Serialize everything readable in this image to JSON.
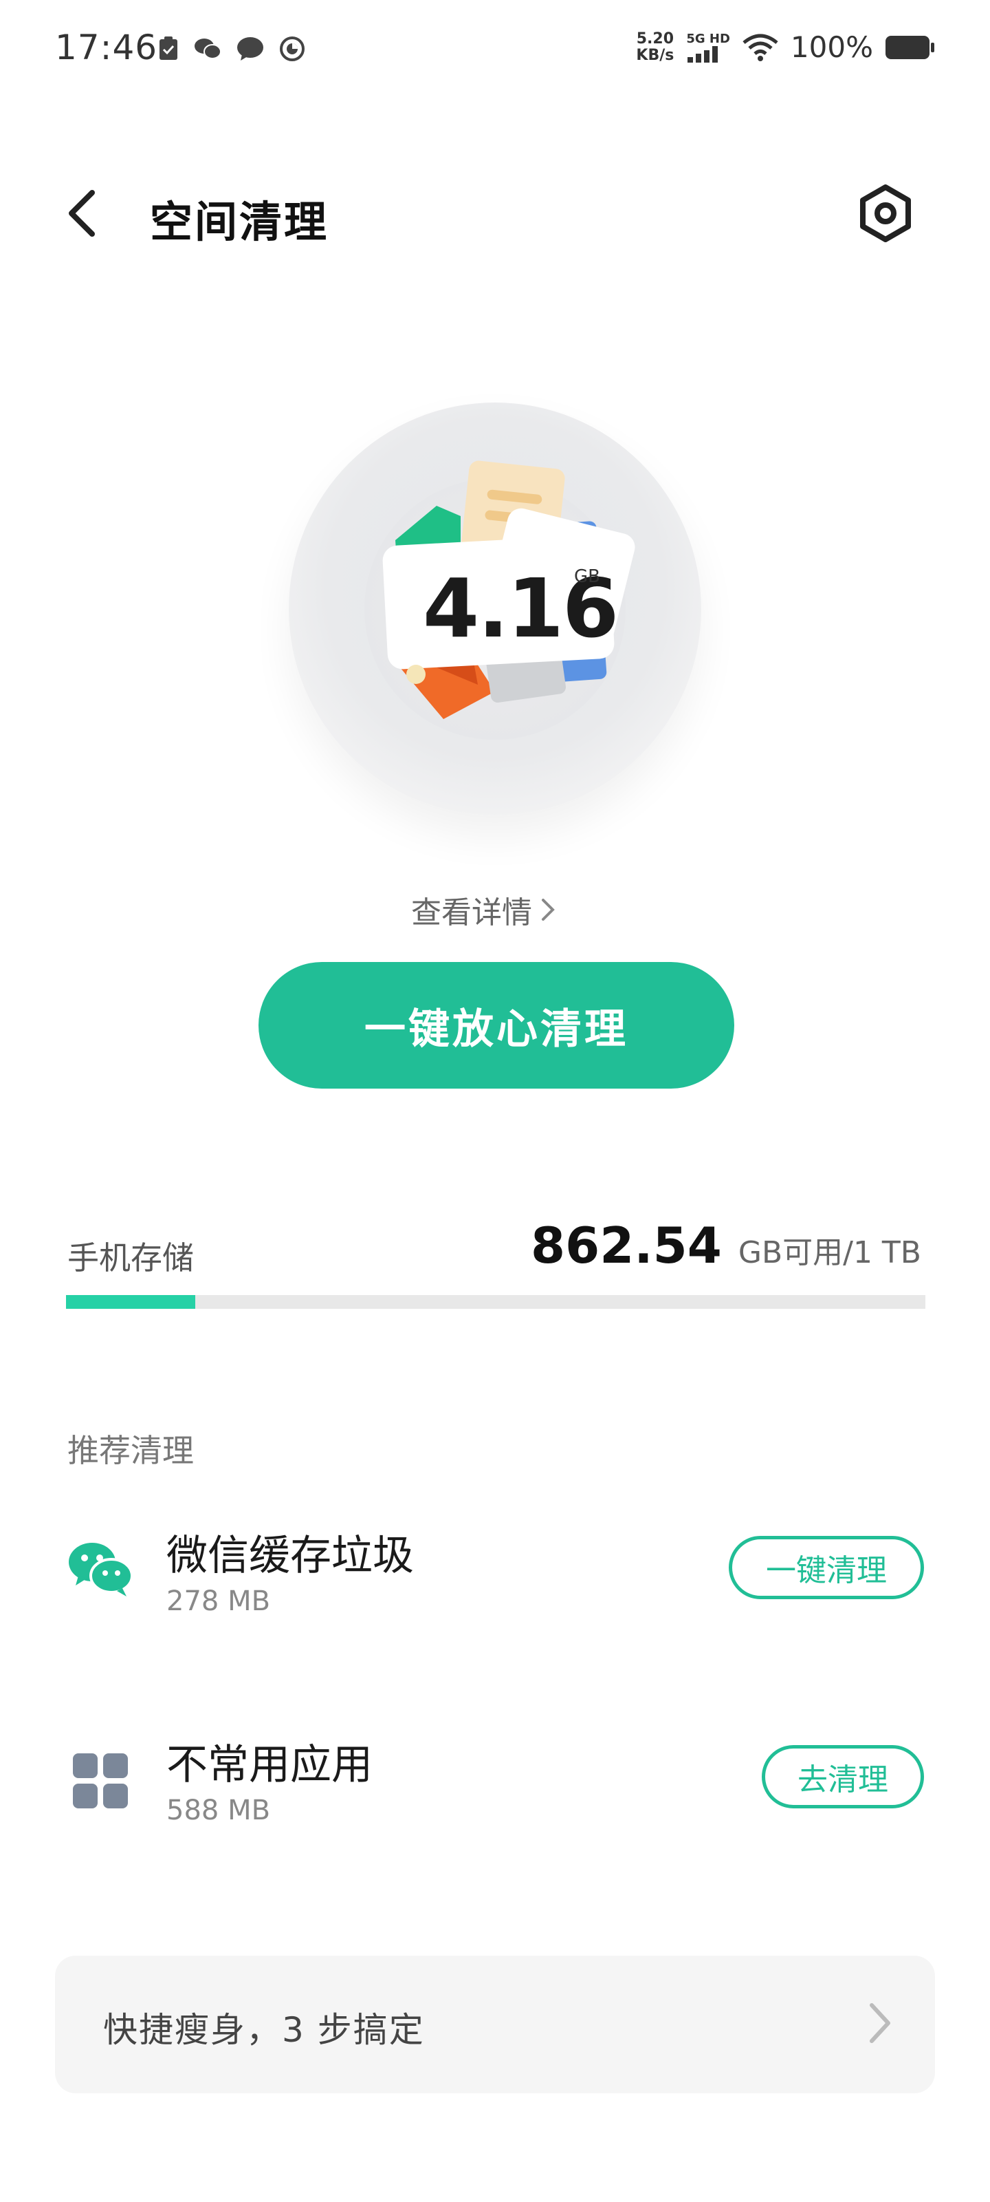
{
  "status_bar": {
    "time": "17:46",
    "net_speed_value": "5.20",
    "net_speed_unit": "KB/s",
    "network_type": "5G HD",
    "battery": "100%"
  },
  "header": {
    "title": "空间清理"
  },
  "hero": {
    "junk_value": "4.16",
    "junk_unit": "GB",
    "details_link": "查看详情"
  },
  "primary_action": {
    "label": "一键放心清理"
  },
  "storage": {
    "label": "手机存储",
    "available": "862.54",
    "suffix": "GB可用/1 TB",
    "used_fraction": 0.15
  },
  "recommend": {
    "title": "推荐清理",
    "items": [
      {
        "name": "微信缓存垃圾",
        "size": "278 MB",
        "action": "一键清理",
        "icon": "wechat-icon"
      },
      {
        "name": "不常用应用",
        "size": "588 MB",
        "action": "去清理",
        "icon": "apps-grid-icon"
      }
    ]
  },
  "quick_slim": {
    "label": "快捷瘦身，3 步搞定"
  },
  "colors": {
    "accent": "#21be96",
    "storage_fill": "#26d1a6"
  }
}
